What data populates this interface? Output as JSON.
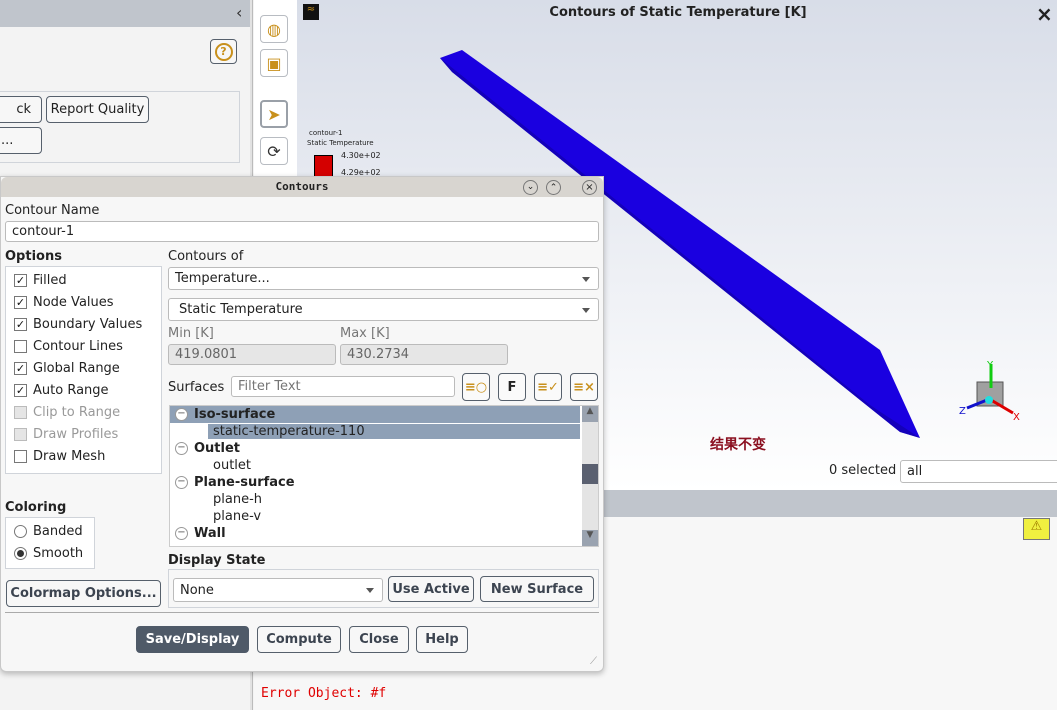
{
  "left_panel": {
    "collapse": "‹",
    "help": "?",
    "btn_check_partial": "ck",
    "btn_report_quality": "Report Quality",
    "btn_more_partial": "..."
  },
  "graphics": {
    "title": "Contours of Static Temperature [K]",
    "close": "×",
    "legend": {
      "name": "contour-1",
      "variable": "Static Temperature",
      "max_label": "4.30e+02",
      "next_label": "4.29e+02",
      "color": "#d40000"
    },
    "annotation": "结果不变",
    "selected_count": "0 selected",
    "selection_filter": "all",
    "body_color": "#1a00e0",
    "axes": {
      "x": "X",
      "y": "Y",
      "z": "Z"
    }
  },
  "console": {
    "error_text": "Error Object: #f"
  },
  "dialog": {
    "title": "Contours",
    "contour_name_label": "Contour Name",
    "contour_name": "contour-1",
    "options_label": "Options",
    "options": [
      {
        "label": "Filled",
        "checked": true,
        "enabled": true
      },
      {
        "label": "Node Values",
        "checked": true,
        "enabled": true
      },
      {
        "label": "Boundary Values",
        "checked": true,
        "enabled": true
      },
      {
        "label": "Contour Lines",
        "checked": false,
        "enabled": true
      },
      {
        "label": "Global Range",
        "checked": true,
        "enabled": true
      },
      {
        "label": "Auto Range",
        "checked": true,
        "enabled": true
      },
      {
        "label": "Clip to Range",
        "checked": false,
        "enabled": false
      },
      {
        "label": "Draw Profiles",
        "checked": false,
        "enabled": false
      },
      {
        "label": "Draw Mesh",
        "checked": false,
        "enabled": true
      }
    ],
    "contours_of_label": "Contours of",
    "category": "Temperature...",
    "variable": "Static Temperature",
    "min_label": "Min [K]",
    "min_value": "419.0801",
    "max_label": "Max [K]",
    "max_value": "430.2734",
    "surfaces_label": "Surfaces",
    "filter_placeholder": "Filter Text",
    "surface_tree": [
      {
        "group": "Iso-surface",
        "selected": true,
        "items": [
          {
            "label": "static-temperature-110",
            "selected": true
          }
        ]
      },
      {
        "group": "Outlet",
        "items": [
          {
            "label": "outlet"
          }
        ]
      },
      {
        "group": "Plane-surface",
        "items": [
          {
            "label": "plane-h"
          },
          {
            "label": "plane-v"
          }
        ]
      },
      {
        "group": "Wall",
        "items": []
      }
    ],
    "coloring_label": "Coloring",
    "coloring": [
      {
        "label": "Banded",
        "selected": false
      },
      {
        "label": "Smooth",
        "selected": true
      }
    ],
    "colormap_options": "Colormap Options...",
    "display_state_label": "Display State",
    "display_state": "None",
    "use_active": "Use Active",
    "new_surface": "New Surface",
    "buttons": {
      "save_display": "Save/Display",
      "compute": "Compute",
      "close": "Close",
      "help": "Help"
    }
  }
}
